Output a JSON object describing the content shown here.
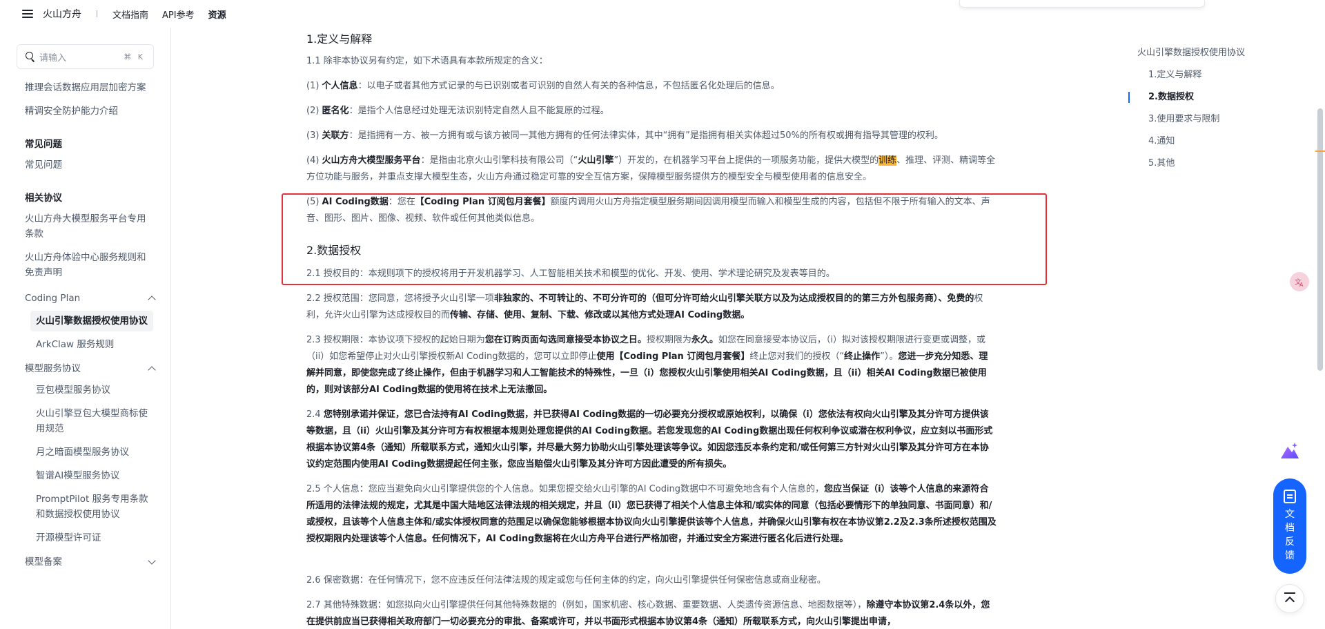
{
  "topbar": {
    "brand": "火山方舟",
    "links": [
      "文档指南",
      "API参考",
      "资源"
    ],
    "active_link": "资源"
  },
  "sidebar": {
    "search_placeholder": "请输入",
    "search_shortcut": "⌘ K",
    "items_top": [
      "推理会话数据应用层加密方案",
      "精调安全防护能力介绍"
    ],
    "faq_heading": "常见问题",
    "faq_items": [
      "常见问题"
    ],
    "agreements_heading": "相关协议",
    "agreements_items": [
      "火山方舟大模型服务平台专用条款",
      "火山方舟体验中心服务规则和免责声明"
    ],
    "coding_plan_group": "Coding Plan",
    "coding_plan_items": [
      "火山引擎数据授权使用协议",
      "ArkClaw 服务规则"
    ],
    "model_service_group": "模型服务协议",
    "model_service_items": [
      "豆包模型服务协议",
      "火山引擎豆包大模型商标使用规范",
      "月之暗面模型服务协议",
      "智谱AI模型服务协议",
      "PromptPilot 服务专用条款和数据授权使用协议",
      "开源模型许可证"
    ],
    "model_filing_group": "模型备案"
  },
  "content": {
    "s1_title": "1.定义与解释",
    "p1_1": "1.1 除非本协议另有约定，如下术语具有本款所规定的含义：",
    "p_def1_pre": "(1) ",
    "p_def1_term": "个人信息",
    "p_def1_text": "：以电子或者其他方式记录的与已识别或者可识别的自然人有关的各种信息，不包括匿名化处理后的信息。",
    "p_def2_pre": "(2) ",
    "p_def2_term": "匿名化",
    "p_def2_text": "：是指个人信息经过处理无法识别特定自然人且不能复原的过程。",
    "p_def3_pre": "(3) ",
    "p_def3_term": "关联方",
    "p_def3_text": "：是指拥有一方、被一方拥有或与该方被同一其他方拥有的任何法律实体，其中“拥有”是指拥有相关实体超过50%的所有权或拥有指导其管理的权利。",
    "p_def4_pre": "(4) ",
    "p_def4_term": "火山方舟大模型服务平台",
    "p_def4_text_a": "：是指由北京火山引擎科技有限公司（“",
    "p_def4_term2": "火山引擎",
    "p_def4_text_b": "”）开发的，在机器学习平台上提供的一项服务功能，提供大模型的",
    "p_def4_hl": "训练",
    "p_def4_text_c": "、推理、评测、精调等全方位功能与服务，并重点支撑大模型生态，火山方舟通过稳定可靠的安全互信方案，保障模型服务提供方的模型安全与模型使用者的信息安全。",
    "p_def5_pre": "(5) ",
    "p_def5_term": "AI Coding数据",
    "p_def5_text_a": "：您在",
    "p_def5_term2": "【Coding Plan 订阅包月套餐】",
    "p_def5_text_b": "额度内调用火山方舟指定模型服务期间因调用模型而输入和模型生成的内容，包括但不限于所有输入的文本、声音、图形、图片、图像、视频、软件或任何其他类似信息。",
    "s2_title": "2.数据授权",
    "p2_1": "2.1 授权目的：本规则项下的授权将用于开发机器学习、人工智能相关技术和模型的优化、开发、使用、学术理论研究及发表等目的。",
    "p2_2_a": "2.2 授权范围：您同意，您将授予火山引擎一项",
    "p2_2_b": "非独家的、不可转让的、不可分许可的（但可分许可给火山引擎关联方以及为达成授权目的的第三方外包服务商）、免费的",
    "p2_2_c": "权利，允许火山引擎为达成授权目的而",
    "p2_2_d": "传输、存储、使用、复制、下载、修改或以其他方式处理AI Coding数据。",
    "p2_3_a": "2.3 授权期限：本协议项下授权的起始日期为",
    "p2_3_b": "您在订购页面勾选同意接受本协议之日。",
    "p2_3_c": "授权期限为",
    "p2_3_d": "永久。",
    "p2_3_e": "如您在同意接受本协议后，（i）拟对该授权期限进行变更或调整，或（ii）如您希望停止对火山引擎授权新AI Coding数据的，您可以立即停止",
    "p2_3_f": "使用【Coding Plan 订阅包月套餐】",
    "p2_3_g": "终止您对我们的授权（“",
    "p2_3_h": "终止操作",
    "p2_3_i": "”）。",
    "p2_3_j": "您进一步充分知悉、理解并同意，即使您完成了终止操作，但由于机器学习和人工智能技术的特殊性，一旦（i）您授权火山引擎使用相关AI Coding数据，且（ii）相关AI Coding数据已被使用的，则对该部分AI Coding数据的使用将在技术上无法撤回。",
    "p2_4_a": "2.4 ",
    "p2_4_b": "您特别承诺并保证，您已合法持有AI Coding数据，并已获得AI Coding数据的一切必要充分授权或原始权利，以确保（i）您依法有权向火山引擎及其分许可方提供该等数据，且（ii）火山引擎及其分许可方有权根据本规则处理您提供的AI Coding数据。若您发现您的AI Coding数据出现任何权利争议或潜在权利争议，应立刻以书面形式根据本协议第4条（通知）所载联系方式，通知火山引擎，并尽最大努力协助火山引擎处理该等争议。如因您违反本条约定和/或任何第三方针对火山引擎及其分许可方在本协议约定范围内使用AI Coding数据提起任何主张，您应当赔偿火山引擎及其分许可方因此遭受的所有损失。",
    "p2_5_a": "2.5 个人信息：您应当避免向火山引擎提供您的个人信息。如果您提交给火山引擎的AI Coding数据中不可避免地含有个人信息的，",
    "p2_5_b": "您应当保证（i）该等个人信息的来源符合所适用的法律法规的规定，尤其是中国大陆地区法律法规的相关规定，并且（ii）您已获得了相关个人信息主体和/或实体的同意（包括必要情形下的单独同意、书面同意）和/或授权，且该等个人信息主体和/或实体授权同意的范围足以确保您能够根据本协议向火山引擎提供该等个人信息，并确保火山引擎有权在本协议第2.2及2.3条所述授权范围及授权期限内处理该等个人信息。任何情况下，AI Coding数据将在火山方舟平台进行严格加密，并通过安全方案进行匿名化后进行处理。",
    "p2_6": "2.6 保密数据：在任何情况下，您不应违反任何法律法规的规定或您与任何主体的约定，向火山引擎提供任何保密信息或商业秘密。",
    "p2_7_a": "2.7 其他特殊数据：如您拟向火山引擎提供任何其他特殊数据的（例如，国家机密、核心数据、重要数据、人类遗传资源信息、地图数据等），",
    "p2_7_b": "除遵守本协议第2.4条以外，您在提供前应当已获得相关政府部门一切必要充分的审批、备案或许可，并以书面形式根据本协议第4条（通知）所载联系方式，向火山引擎提出申请，"
  },
  "toc": {
    "title": "火山引擎数据授权使用协议",
    "items": [
      "1.定义与解释",
      "2.数据授权",
      "3.使用要求与限制",
      "4.通知",
      "5.其他"
    ],
    "active_index": 1
  },
  "floating": {
    "feedback_label": "文档反馈"
  },
  "colors": {
    "accent": "#1664ff",
    "highlight_box": "#e5303a",
    "text_highlight": "#fcb636"
  }
}
